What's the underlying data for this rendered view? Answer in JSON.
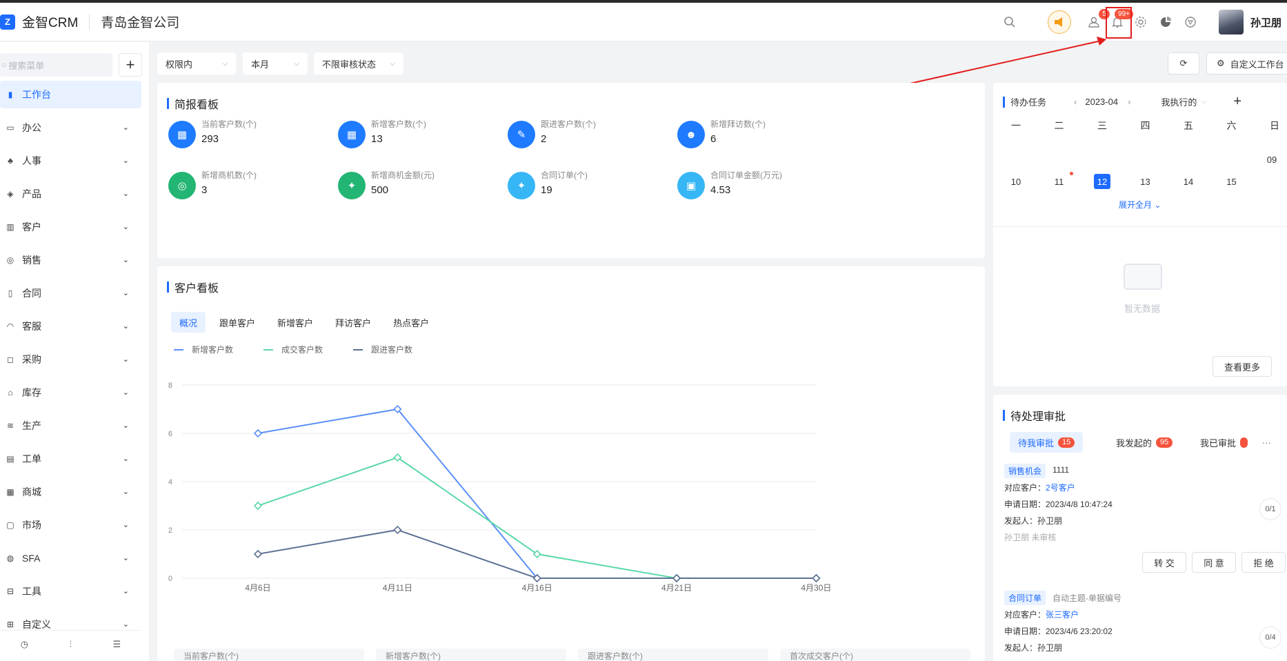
{
  "header": {
    "logo_text": "金智CRM",
    "company": "青岛金智公司",
    "mail_badge": "5",
    "bell_badge": "99+",
    "user_name": "孙卫朋"
  },
  "sidebar": {
    "search_placeholder": "搜索菜单",
    "add_label": "+",
    "items": [
      {
        "label": "工作台",
        "icon": "dashboard-icon"
      },
      {
        "label": "办公",
        "icon": "office-icon"
      },
      {
        "label": "人事",
        "icon": "org-icon"
      },
      {
        "label": "产品",
        "icon": "box-icon"
      },
      {
        "label": "客户",
        "icon": "bar-icon"
      },
      {
        "label": "销售",
        "icon": "sales-icon"
      },
      {
        "label": "合同",
        "icon": "contract-icon"
      },
      {
        "label": "客服",
        "icon": "headset-icon"
      },
      {
        "label": "采购",
        "icon": "purchase-icon"
      },
      {
        "label": "库存",
        "icon": "warehouse-icon"
      },
      {
        "label": "生产",
        "icon": "production-icon"
      },
      {
        "label": "工单",
        "icon": "ticket-icon"
      },
      {
        "label": "商城",
        "icon": "store-icon"
      },
      {
        "label": "市场",
        "icon": "market-icon"
      },
      {
        "label": "SFA",
        "icon": "sfa-icon"
      },
      {
        "label": "工具",
        "icon": "toolbox-icon"
      },
      {
        "label": "自定义",
        "icon": "grid-icon"
      }
    ]
  },
  "filters": {
    "scope": "权限内",
    "period": "本月",
    "status": "不限审核状态"
  },
  "toolbar": {
    "customize": "自定义工作台"
  },
  "brief": {
    "title": "简报看板",
    "stats": [
      {
        "label": "当前客户数(个)",
        "value": "293",
        "color": "#1e7bff"
      },
      {
        "label": "新增客户数(个)",
        "value": "13",
        "color": "#1e7bff"
      },
      {
        "label": "跟进客户数(个)",
        "value": "2",
        "color": "#1e7bff"
      },
      {
        "label": "新增拜访数(个)",
        "value": "6",
        "color": "#1e7bff"
      },
      {
        "label": "新增商机数(个)",
        "value": "3",
        "color": "#22b573"
      },
      {
        "label": "新增商机金额(元)",
        "value": "500",
        "color": "#22b573"
      },
      {
        "label": "合同订单(个)",
        "value": "19",
        "color": "#36b6f5"
      },
      {
        "label": "合同订单金额(万元)",
        "value": "4.53",
        "color": "#36b6f5"
      }
    ]
  },
  "customer_board": {
    "title": "客户看板",
    "tabs": [
      "概况",
      "跟单客户",
      "新增客户",
      "拜访客户",
      "热点客户"
    ],
    "mini_cards": [
      "当前客户数(个)",
      "新增客户数(个)",
      "跟进客户数(个)",
      "首次成交客户(个)"
    ]
  },
  "chart_data": {
    "type": "line",
    "x": [
      "4月6日",
      "4月11日",
      "4月16日",
      "4月21日",
      "4月30日"
    ],
    "ylim": [
      0,
      8
    ],
    "yticks": [
      0,
      2,
      4,
      6,
      8
    ],
    "legend_position": "top-left",
    "grid": true,
    "series": [
      {
        "name": "新增客户数",
        "color": "#5b8ff9",
        "values": [
          6,
          7,
          0,
          0,
          0
        ]
      },
      {
        "name": "成交客户数",
        "color": "#5ad8a6",
        "values": [
          3,
          5,
          1,
          0,
          0
        ]
      },
      {
        "name": "跟进客户数",
        "color": "#5d7092",
        "values": [
          1,
          2,
          0,
          0,
          0
        ]
      }
    ]
  },
  "todo": {
    "title": "待办任务",
    "month": "2023-04",
    "filter": "我执行的",
    "add_label": "+",
    "weekdays": [
      "一",
      "二",
      "三",
      "四",
      "五",
      "六",
      "日"
    ],
    "row1_sunday": "09",
    "days": [
      "10",
      "11",
      "12",
      "13",
      "14",
      "15"
    ],
    "selected_day": "12",
    "expand": "展开全月",
    "empty": "暂无数据",
    "more": "查看更多"
  },
  "approval": {
    "title": "待处理审批",
    "tabs": [
      {
        "label": "待我审批",
        "count": "15"
      },
      {
        "label": "我发起的",
        "count": "95"
      },
      {
        "label": "我已审批",
        "count": ""
      }
    ],
    "more_label": "···",
    "items": [
      {
        "tag": "销售机会",
        "subject": "1111",
        "customer_label": "对应客户：",
        "customer": "2号客户",
        "date": "申请日期：2023/4/8 10:47:24",
        "initiator": "发起人：孙卫朋",
        "status": "孙卫朋 未审核",
        "progress": "0/1"
      },
      {
        "tag": "合同订单",
        "subject": "自动主题-单据编号",
        "customer_label": "对应客户：",
        "customer": "张三客户",
        "date": "申请日期：2023/4/6 23:20:02",
        "initiator": "发起人：孙卫朋",
        "progress": "0/4"
      }
    ],
    "buttons": {
      "transfer": "转 交",
      "agree": "同 意",
      "reject": "拒 绝"
    }
  }
}
